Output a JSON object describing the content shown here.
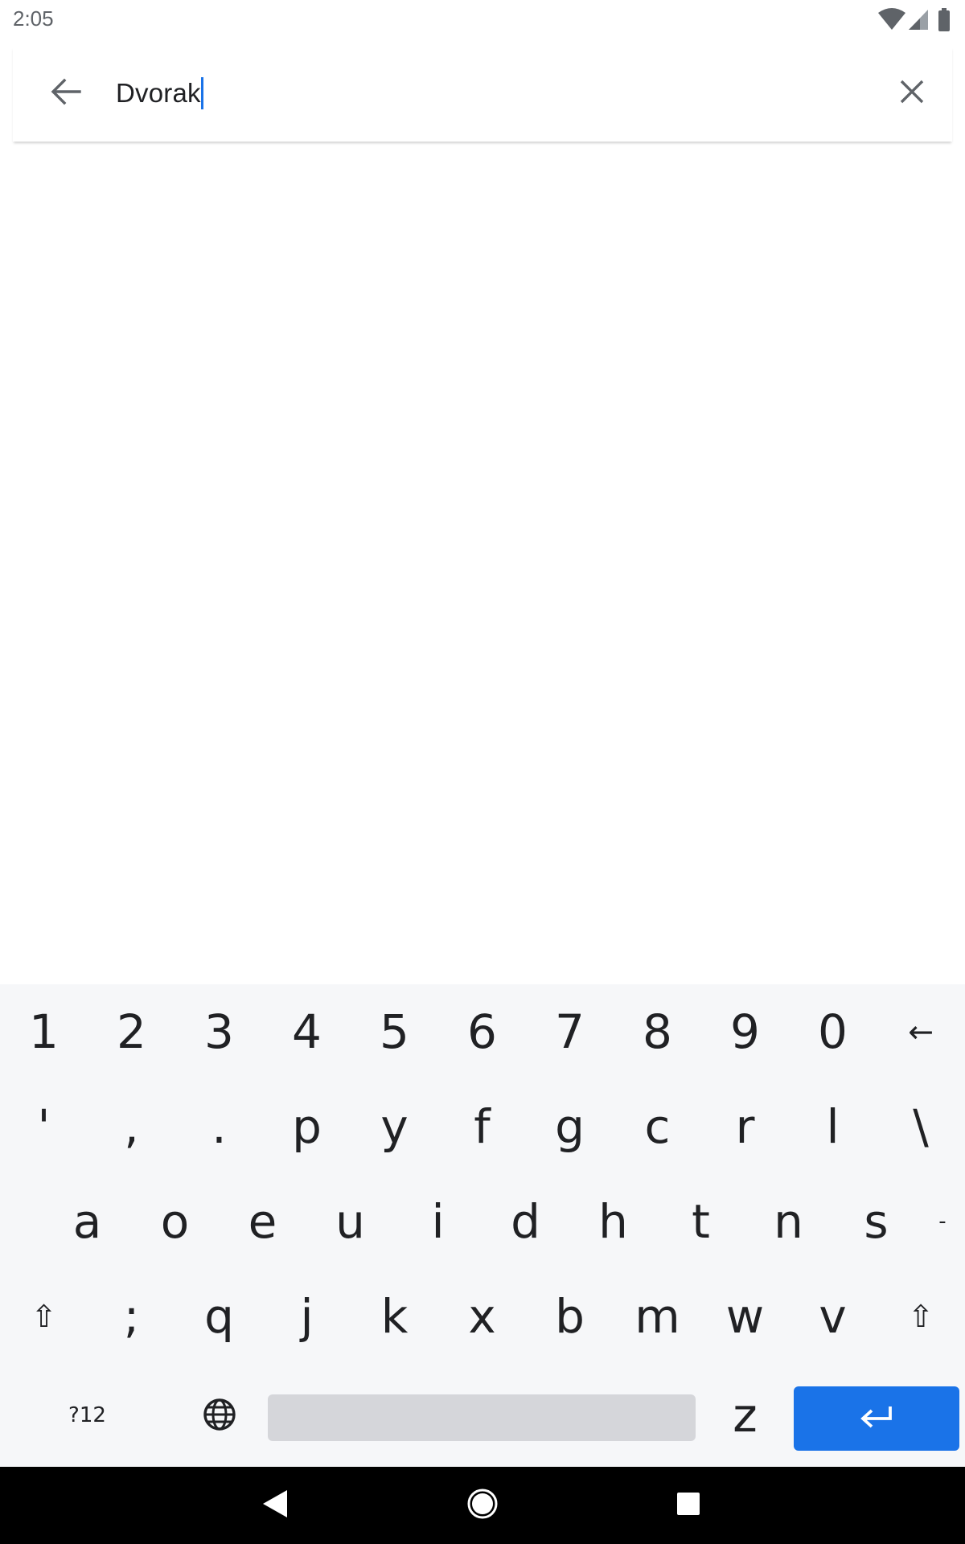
{
  "status_bar": {
    "time": "2:05",
    "icons": [
      "wifi-icon",
      "cell-signal-icon",
      "battery-icon"
    ]
  },
  "search": {
    "value": "Dvorak",
    "back_icon": "arrow-back-icon",
    "clear_icon": "close-icon",
    "caret_color": "#1a73e8"
  },
  "keyboard": {
    "layout": "Dvorak",
    "rows": [
      [
        "1",
        "2",
        "3",
        "4",
        "5",
        "6",
        "7",
        "8",
        "9",
        "0",
        "←"
      ],
      [
        "'",
        ",",
        ".",
        "p",
        "y",
        "f",
        "g",
        "c",
        "r",
        "l",
        "\\"
      ],
      [
        "a",
        "o",
        "e",
        "u",
        "i",
        "d",
        "h",
        "t",
        "n",
        "s",
        "-"
      ],
      [
        "⇧",
        ";",
        "q",
        "j",
        "k",
        "x",
        "b",
        "m",
        "w",
        "v",
        "⇧"
      ]
    ],
    "bottom_row": {
      "symbols_label": "?12",
      "language_icon": "globe-icon",
      "z_key": "z",
      "enter_icon": "enter-icon"
    },
    "colors": {
      "background": "#f6f7f9",
      "space": "#d5d6da",
      "enter": "#1a73e8"
    }
  },
  "navigation_bar": {
    "buttons": [
      "back-triangle-icon",
      "home-circle-icon",
      "recents-square-icon"
    ]
  }
}
